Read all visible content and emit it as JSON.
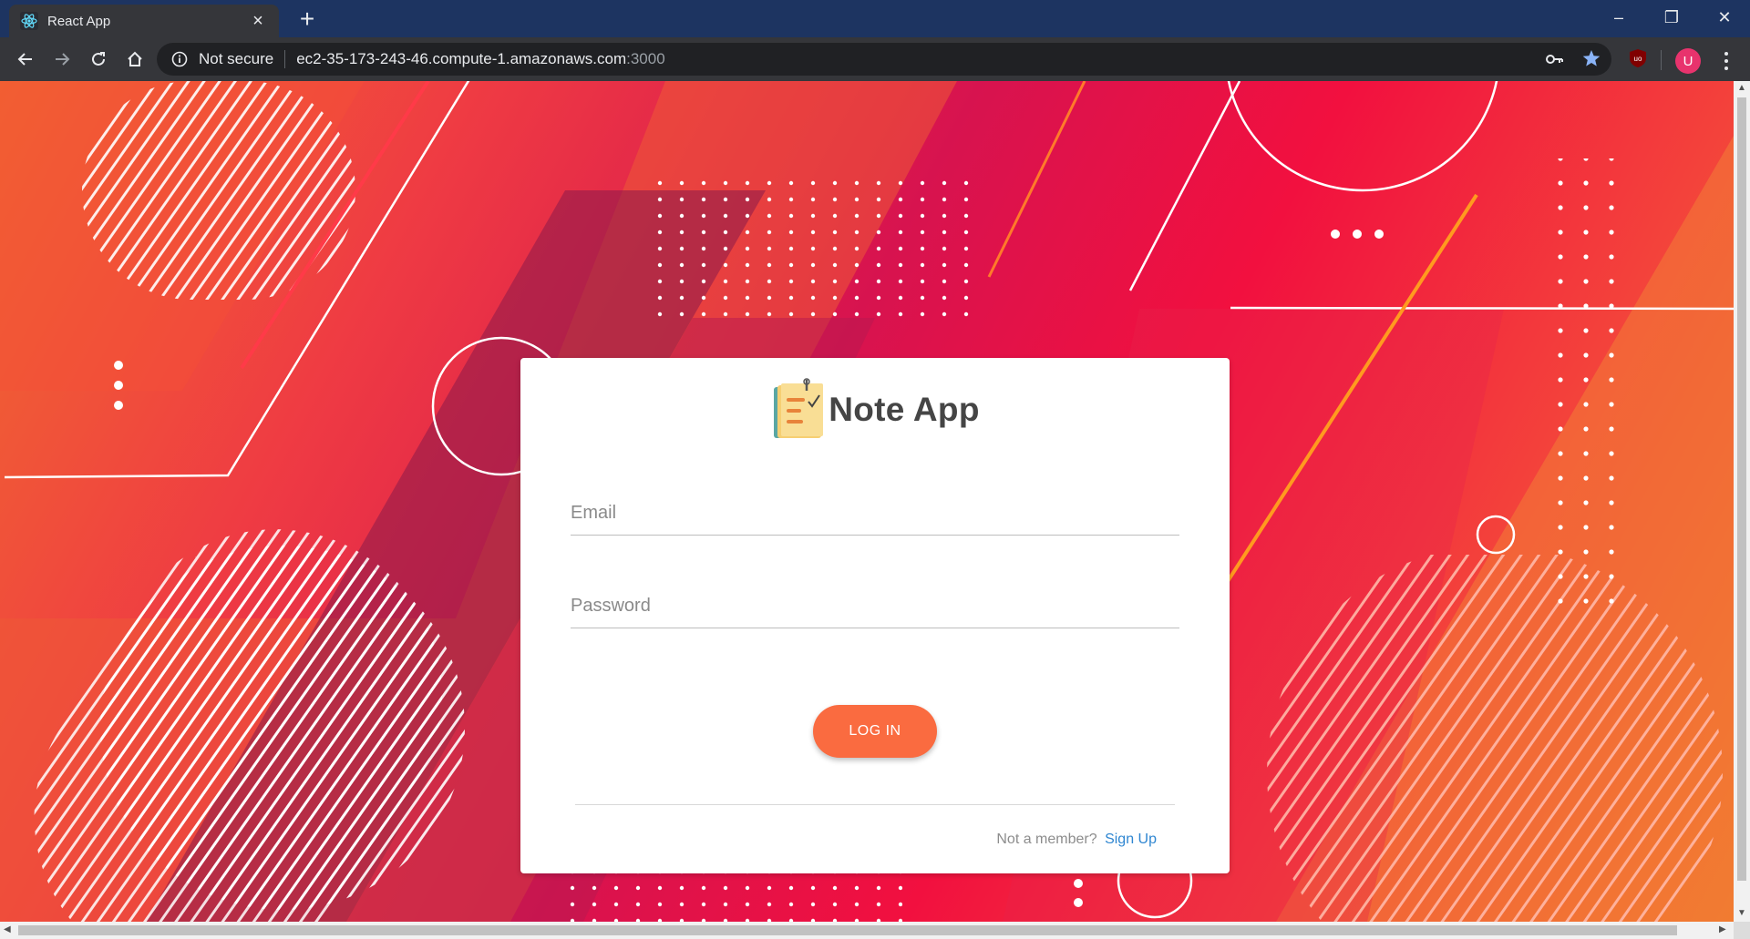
{
  "browser": {
    "tab": {
      "title": "React App",
      "favicon": "react-logo-icon",
      "close_label": "×"
    },
    "new_tab_label": "+",
    "window_controls": {
      "minimize": "–",
      "restore": "❐",
      "close": "✕"
    },
    "address_bar": {
      "security_label": "Not secure",
      "host": "ec2-35-173-243-46.compute-1.amazonaws.com",
      "port": ":3000"
    },
    "profile_initial": "U",
    "icons": {
      "back": "arrow-left-icon",
      "forward": "arrow-right-icon",
      "reload": "reload-icon",
      "home": "home-icon",
      "info": "info-icon",
      "key": "key-icon",
      "bookmark": "star-icon",
      "extension": "ublock-icon",
      "menu": "kebab-menu-icon"
    },
    "colors": {
      "tabbar": "#1d3461",
      "toolbar": "#35363a",
      "star": "#8ab4f8",
      "avatar": "#e8336d"
    }
  },
  "login": {
    "app_name": "Note App",
    "logo_icon": "notepad-icon",
    "email_placeholder": "Email",
    "password_placeholder": "Password",
    "login_button": "LOG IN",
    "footer_text": "Not a member?",
    "signup_link": "Sign Up",
    "colors": {
      "button": "#fa6b40",
      "link": "#2f86d1"
    }
  }
}
